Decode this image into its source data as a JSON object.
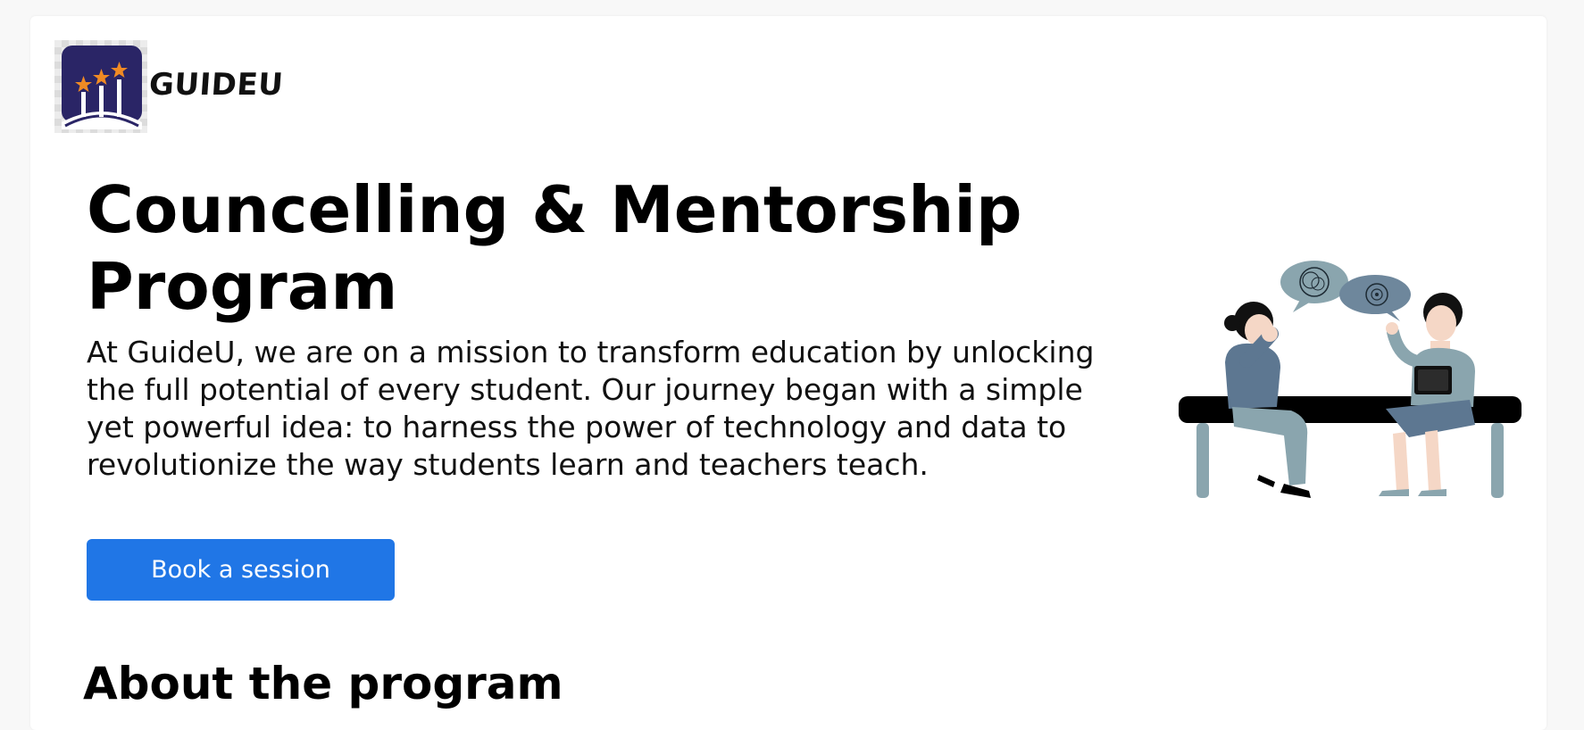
{
  "header": {
    "brand": "GUIDEU"
  },
  "hero": {
    "title": "Councelling & Mentorship Program",
    "description": "At GuideU, we are on a mission to transform education by unlocking the full potential of every student. Our journey began with a simple yet powerful idea: to harness the power of technology and data to revolutionize the way students learn and teachers teach.",
    "cta_label": "Book a session"
  },
  "about": {
    "title": "About the program"
  },
  "icons": {
    "logo": "stars-podium-logo-icon",
    "illustration": "two-girls-talking-on-bench-illustration"
  },
  "colors": {
    "cta": "#2076e6",
    "logo_bg": "#2a2566",
    "logo_star": "#f08a24"
  }
}
